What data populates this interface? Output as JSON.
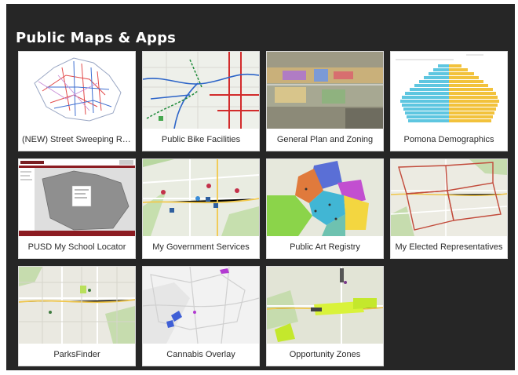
{
  "page": {
    "title": "Public Maps & Apps"
  },
  "colors": {
    "panel_bg": "#262626",
    "card_bg": "#ffffff",
    "title_text": "#ffffff",
    "label_text": "#2b2b2b"
  },
  "cards": [
    {
      "label": "(NEW) Street Sweeping Routes..."
    },
    {
      "label": "Public Bike Facilities"
    },
    {
      "label": "General Plan and Zoning"
    },
    {
      "label": "Pomona Demographics"
    },
    {
      "label": "PUSD My School Locator"
    },
    {
      "label": "My Government Services"
    },
    {
      "label": "Public Art Registry"
    },
    {
      "label": "My Elected Representatives"
    },
    {
      "label": "ParksFinder"
    },
    {
      "label": "Cannabis Overlay"
    },
    {
      "label": "Opportunity Zones"
    }
  ]
}
